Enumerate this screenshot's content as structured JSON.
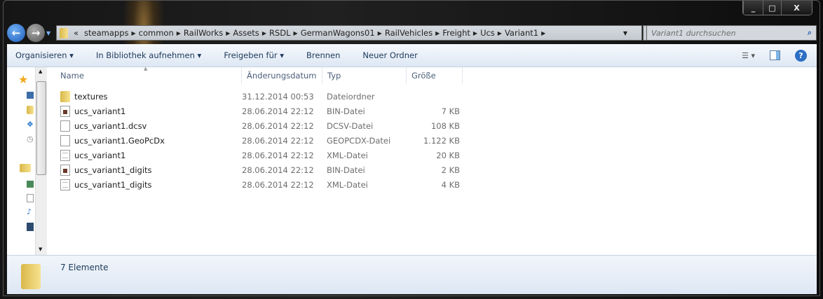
{
  "window": {
    "controls": [
      "_",
      "□",
      "X"
    ]
  },
  "address": {
    "prefix": "«",
    "segments": [
      "steamapps",
      "common",
      "RailWorks",
      "Assets",
      "RSDL",
      "GermanWagons01",
      "RailVehicles",
      "Freight",
      "Ucs",
      "Variant1"
    ]
  },
  "search": {
    "placeholder": "Variant1 durchsuchen"
  },
  "toolbar": {
    "organize": "Organisieren ▾",
    "library": "In Bibliothek aufnehmen ▾",
    "share": "Freigeben für ▾",
    "burn": "Brennen",
    "new_folder": "Neuer Ordner"
  },
  "columns": {
    "name": "Name",
    "date": "Änderungsdatum",
    "type": "Typ",
    "size": "Größe"
  },
  "files": [
    {
      "name": "textures",
      "date": "31.12.2014 00:53",
      "type": "Dateiordner",
      "size": "",
      "icon": "folder"
    },
    {
      "name": "ucs_variant1",
      "date": "28.06.2014 22:12",
      "type": "BIN-Datei",
      "size": "7 KB",
      "icon": "bin"
    },
    {
      "name": "ucs_variant1.dcsv",
      "date": "28.06.2014 22:12",
      "type": "DCSV-Datei",
      "size": "108 KB",
      "icon": "file"
    },
    {
      "name": "ucs_variant1.GeoPcDx",
      "date": "28.06.2014 22:12",
      "type": "GEOPCDX-Datei",
      "size": "1.122 KB",
      "icon": "file"
    },
    {
      "name": "ucs_variant1",
      "date": "28.06.2014 22:12",
      "type": "XML-Datei",
      "size": "20 KB",
      "icon": "xml"
    },
    {
      "name": "ucs_variant1_digits",
      "date": "28.06.2014 22:12",
      "type": "BIN-Datei",
      "size": "2 KB",
      "icon": "bin"
    },
    {
      "name": "ucs_variant1_digits",
      "date": "28.06.2014 22:12",
      "type": "XML-Datei",
      "size": "4 KB",
      "icon": "xml"
    }
  ],
  "status": {
    "count": "7 Elemente"
  }
}
